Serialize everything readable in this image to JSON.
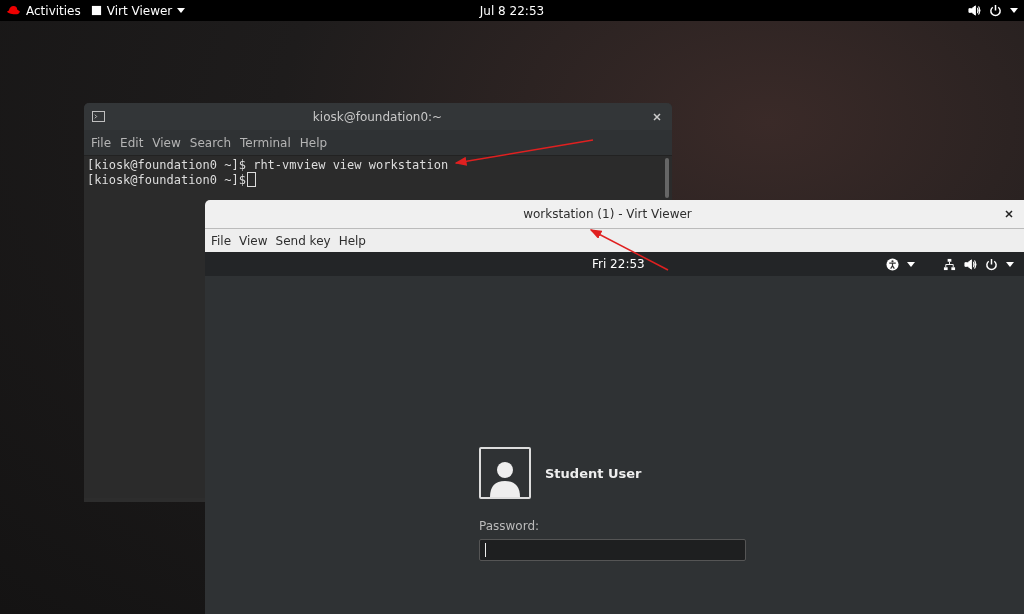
{
  "top_bar": {
    "activities": "Activities",
    "app_menu": "Virt Viewer",
    "clock": "Jul 8  22:53"
  },
  "terminal": {
    "title": "kiosk@foundation0:~",
    "menu": [
      "File",
      "Edit",
      "View",
      "Search",
      "Terminal",
      "Help"
    ],
    "lines": [
      {
        "prompt": "[kiosk@foundation0 ~]$ ",
        "command": "rht-vmview view workstation"
      },
      {
        "prompt": "[kiosk@foundation0 ~]$ "
      }
    ]
  },
  "viewer": {
    "title": "workstation (1) - Virt Viewer",
    "menu": [
      "File",
      "View",
      "Send key",
      "Help"
    ],
    "guest": {
      "clock": "Fri 22:53",
      "user_name": "Student User",
      "password_label": "Password:"
    }
  }
}
